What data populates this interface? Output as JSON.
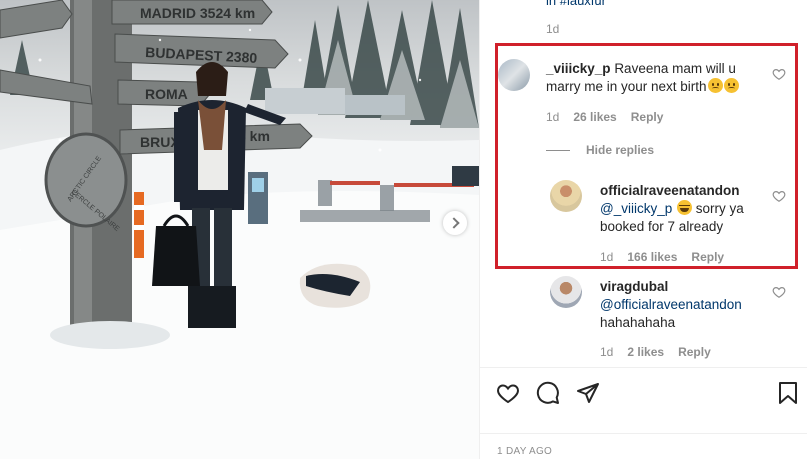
{
  "photo": {
    "signs": [
      "MADRID 3524 km",
      "BUDAPEST 2380",
      "ROMA",
      "BRUX",
      "8 km"
    ],
    "pole_text": [
      "ARCTIC CIRCLE",
      "CERCLE POLAIRE"
    ]
  },
  "previous": {
    "text": "in #lauxfur",
    "time": "1d"
  },
  "comments": [
    {
      "username": "_viiicky_p",
      "text": "Raveena mam will u marry me in your next birth",
      "time": "1d",
      "likes": "26 likes",
      "reply": "Reply"
    }
  ],
  "hide_replies": "Hide replies",
  "replies": [
    {
      "username": "officialraveenatandon",
      "mention": "@_viiicky_p",
      "text": "sorry ya booked for 7 already",
      "time": "1d",
      "likes": "166 likes",
      "reply": "Reply"
    },
    {
      "username": "viragdubal",
      "mention": "@officialraveenatandon",
      "text": "hahahahaha",
      "time": "1d",
      "likes": "2 likes",
      "reply": "Reply"
    }
  ],
  "post": {
    "timestamp": "1 DAY AGO"
  },
  "icons": {
    "like": "heart-icon",
    "comment": "comment-icon",
    "share": "paper-plane-icon",
    "save": "bookmark-icon",
    "next": "chevron-right-icon"
  },
  "colors": {
    "highlight": "#d0202a",
    "mention": "#00376b",
    "meta": "#8e8e8e"
  }
}
